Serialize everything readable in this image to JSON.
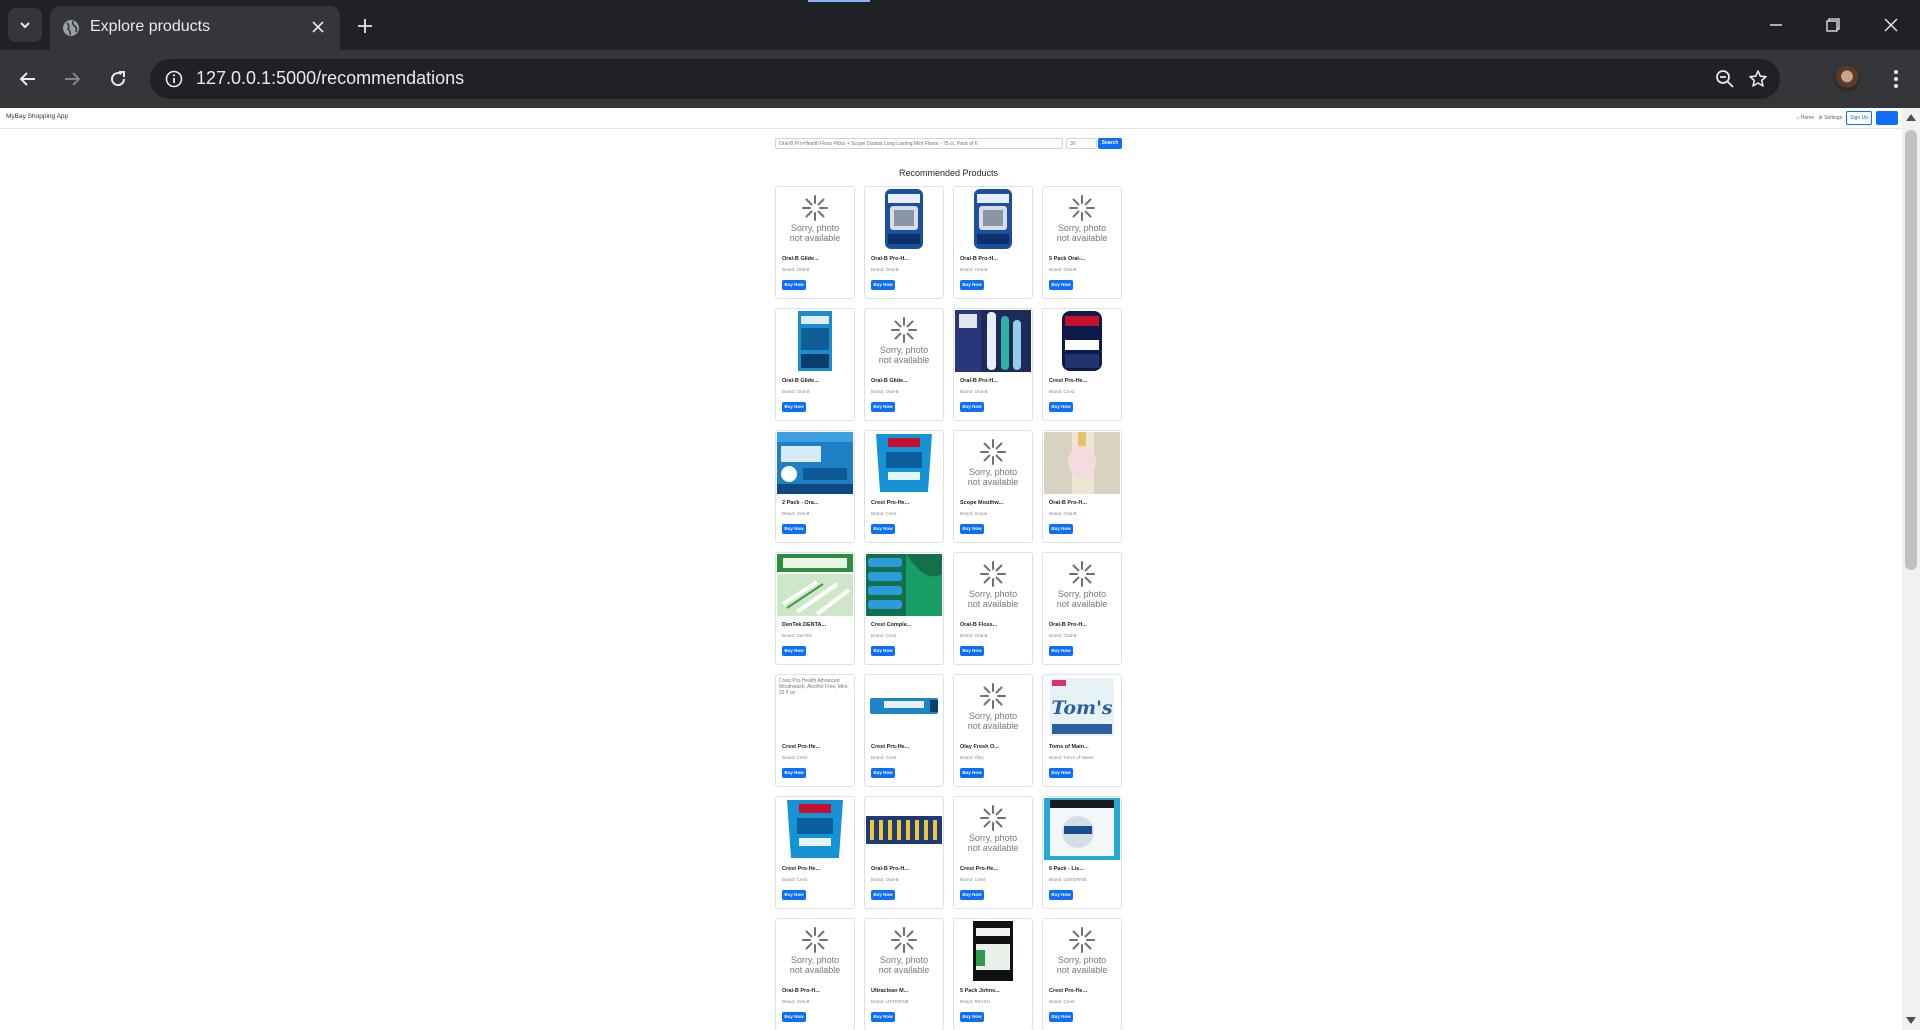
{
  "browser": {
    "tab_title": "Explore products",
    "url": "127.0.0.1:5000/recommendations"
  },
  "app": {
    "brand": "MyBay Shopping App",
    "nav": {
      "home": "Home",
      "settings": "Settings",
      "sign_up": "Sign Up"
    }
  },
  "search": {
    "query": "Oral-B Pro-Health Floss Picks + Scope Outlast Long Lasting Mint Flavor - 75 ct, Pack of 6",
    "count": "30",
    "button": "Search"
  },
  "section_title": "Recommended Products",
  "buy_label": "Buy Now",
  "placeholder_text": {
    "line1": "Sorry, photo",
    "line2": "not available"
  },
  "products": [
    {
      "name": "Oral-B Glide...",
      "brand": "Brand: Oral-B",
      "image": "placeholder"
    },
    {
      "name": "Oral-B Pro-H...",
      "brand": "Brand: Oral-B",
      "image": "floss-pack"
    },
    {
      "name": "Oral-B Pro-H...",
      "brand": "Brand: Oral-B",
      "image": "floss-pack"
    },
    {
      "name": "5 Pack Oral-...",
      "brand": "Brand: Oral-B",
      "image": "placeholder"
    },
    {
      "name": "Oral-B Glide...",
      "brand": "Brand: Oral-B",
      "image": "glide-box"
    },
    {
      "name": "Oral-B Glide...",
      "brand": "Brand: Oral-B",
      "image": "placeholder"
    },
    {
      "name": "Oral-B Pro-H...",
      "brand": "Brand: Oral-B",
      "image": "toothbrush"
    },
    {
      "name": "Crest Pro-He...",
      "brand": "Brand: Crest",
      "image": "crest-clinical"
    },
    {
      "name": "2 Pack - Ora...",
      "brand": "Brand: Oral-B",
      "image": "blue-box"
    },
    {
      "name": "Crest Pro-He...",
      "brand": "Brand: Crest",
      "image": "crest-rinse"
    },
    {
      "name": "Scope Mouthw...",
      "brand": "Brand: Scope",
      "image": "placeholder"
    },
    {
      "name": "Oral-B Pro-H...",
      "brand": "Brand: Oral-B",
      "image": "brush-head"
    },
    {
      "name": "DenTek DENTA...",
      "brand": "Brand: DenTek",
      "image": "dental-picks"
    },
    {
      "name": "Crest Comple...",
      "brand": "Brand: Crest",
      "image": "crest-multi"
    },
    {
      "name": "Oral-B Floss...",
      "brand": "Brand: Oral-B",
      "image": "placeholder"
    },
    {
      "name": "Oral-B Pro-H...",
      "brand": "Brand: Oral-B",
      "image": "placeholder"
    },
    {
      "name": "Crest Pro-He...",
      "brand": "Brand: Crest",
      "image": "broken",
      "alt": "Crest Pro-Health Advanced Mouthwash, Alcohol Free, Mint, 32 fl oz"
    },
    {
      "name": "Crest Pro-He...",
      "brand": "Brand: Crest",
      "image": "toothpaste-tube"
    },
    {
      "name": "Olay Fresh O...",
      "brand": "Brand: Olay",
      "image": "placeholder"
    },
    {
      "name": "Toms of Main...",
      "brand": "Brand: Tom's of Maine",
      "image": "toms"
    },
    {
      "name": "Crest Pro-He...",
      "brand": "Brand: Crest",
      "image": "crest-rinse"
    },
    {
      "name": "Oral-B Pro-H...",
      "brand": "Brand: Oral-B",
      "image": "brush-multi"
    },
    {
      "name": "Crest Pro-He...",
      "brand": "Brand: Crest",
      "image": "placeholder"
    },
    {
      "name": "6 Pack - Lis...",
      "brand": "Brand: LISTERINE",
      "image": "reach-floss"
    },
    {
      "name": "Oral-B Pro-H...",
      "brand": "Brand: Oral-B",
      "image": "placeholder"
    },
    {
      "name": "Ultraclean M...",
      "brand": "Brand: LISTERINE",
      "image": "placeholder"
    },
    {
      "name": "5 Pack Johns...",
      "brand": "Brand: REACH",
      "image": "reach-box"
    },
    {
      "name": "Crest Pro-He...",
      "brand": "Brand: Crest",
      "image": "placeholder"
    }
  ]
}
